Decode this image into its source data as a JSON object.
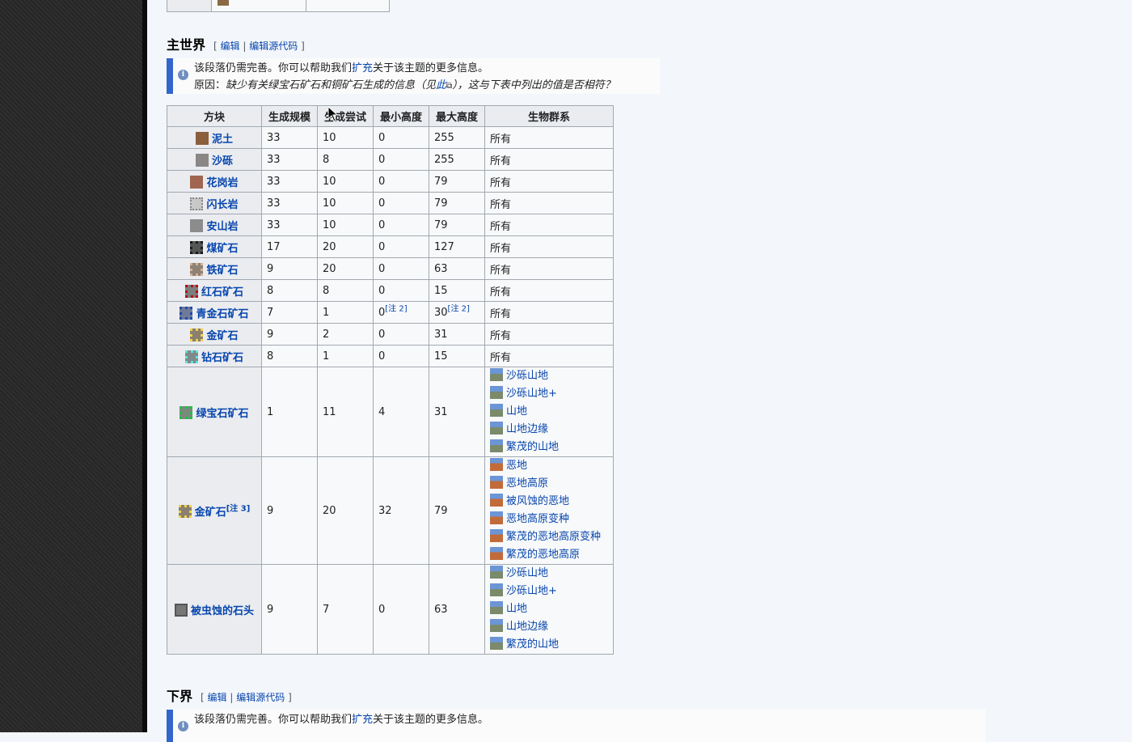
{
  "overworld": {
    "title": "主世界",
    "edit_open": "[",
    "edit": "编辑",
    "sep": "|",
    "edit_source": "编辑源代码",
    "edit_close": "]",
    "notice_line1_pre": "该段落仍需完善。你可以帮助我们",
    "notice_link": "扩充",
    "notice_line1_post": "关于该主题的更多信息。",
    "reason_label": "原因：",
    "reason_pre": "缺少有关绿宝石矿石和铜矿石生成的信息（见",
    "reason_link": "此",
    "reason_post": "），这与下表中列出的值是否相符？"
  },
  "table": {
    "headers": [
      "方块",
      "生成规模",
      "生成尝试",
      "最小高度",
      "最大高度",
      "生物群系"
    ],
    "rows": [
      {
        "block": "泥土",
        "size": "33",
        "tries": "10",
        "min": "0",
        "max": "255",
        "biome": "所有"
      },
      {
        "block": "沙砾",
        "size": "33",
        "tries": "8",
        "min": "0",
        "max": "255",
        "biome": "所有"
      },
      {
        "block": "花岗岩",
        "size": "33",
        "tries": "10",
        "min": "0",
        "max": "79",
        "biome": "所有"
      },
      {
        "block": "闪长岩",
        "size": "33",
        "tries": "10",
        "min": "0",
        "max": "79",
        "biome": "所有"
      },
      {
        "block": "安山岩",
        "size": "33",
        "tries": "10",
        "min": "0",
        "max": "79",
        "biome": "所有"
      },
      {
        "block": "煤矿石",
        "size": "17",
        "tries": "20",
        "min": "0",
        "max": "127",
        "biome": "所有"
      },
      {
        "block": "铁矿石",
        "size": "9",
        "tries": "20",
        "min": "0",
        "max": "63",
        "biome": "所有"
      },
      {
        "block": "红石矿石",
        "size": "8",
        "tries": "8",
        "min": "0",
        "max": "15",
        "biome": "所有"
      },
      {
        "block": "青金石矿石",
        "size": "7",
        "tries": "1",
        "min": "0",
        "min_note": "[注 2]",
        "max": "30",
        "max_note": "[注 2]",
        "biome": "所有"
      },
      {
        "block": "金矿石",
        "size": "9",
        "tries": "2",
        "min": "0",
        "max": "31",
        "biome": "所有"
      },
      {
        "block": "钻石矿石",
        "size": "8",
        "tries": "1",
        "min": "0",
        "max": "15",
        "biome": "所有"
      }
    ],
    "emerald": {
      "block": "绿宝石矿石",
      "size": "1",
      "tries": "11",
      "min": "4",
      "max": "31",
      "biomes": [
        "沙砾山地",
        "沙砾山地+",
        "山地",
        "山地边缘",
        "繁茂的山地"
      ]
    },
    "gold_mesa": {
      "block": "金矿石",
      "note": "[注 3]",
      "size": "9",
      "tries": "20",
      "min": "32",
      "max": "79",
      "biomes": [
        "恶地",
        "恶地高原",
        "被风蚀的恶地",
        "恶地高原变种",
        "繁茂的恶地高原变种",
        "繁茂的恶地高原"
      ]
    },
    "infested": {
      "block": "被虫蚀的石头",
      "size": "9",
      "tries": "7",
      "min": "0",
      "max": "63",
      "biomes": [
        "沙砾山地",
        "沙砾山地+",
        "山地",
        "山地边缘",
        "繁茂的山地"
      ]
    }
  },
  "nether": {
    "title": "下界",
    "edit_open": "[",
    "edit": "编辑",
    "sep": "|",
    "edit_source": "编辑源代码",
    "edit_close": "]",
    "notice_line1_pre": "该段落仍需完善。你可以帮助我们",
    "notice_link": "扩充",
    "notice_line1_post": "关于该主题的更多信息。"
  },
  "colors": {
    "link": "#0645ad",
    "notice_border": "#3366cc",
    "header_bg": "#eaecf0",
    "cell_bg": "#f8f9fa"
  },
  "icons": {
    "info": "information-icon",
    "external": "external-link-icon"
  }
}
